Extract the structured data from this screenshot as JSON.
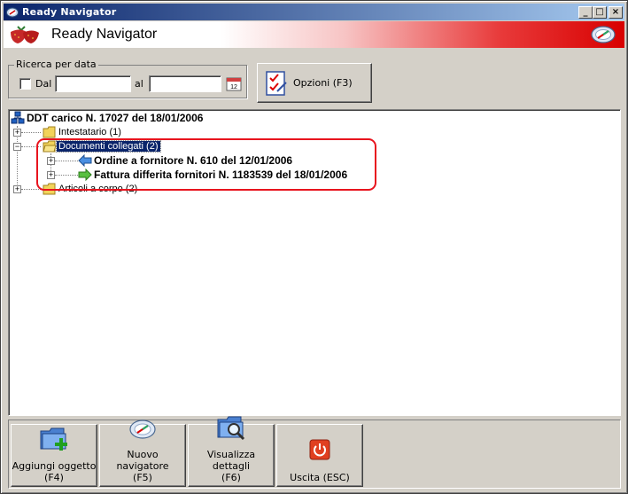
{
  "window": {
    "title": "Ready Navigator",
    "controls": {
      "minimize": "_",
      "maximize": "□",
      "close": "×"
    }
  },
  "banner": {
    "title": "Ready Navigator"
  },
  "search": {
    "group_label": "Ricerca per data",
    "from_label": "Dal",
    "from_value": "",
    "to_label": "al",
    "to_value": "",
    "from_checked": false
  },
  "options_button": {
    "label": "Opzioni (F3)"
  },
  "tree": {
    "root": "DDT carico N. 17027 del 18/01/2006",
    "items": [
      {
        "label": "Intestatario (1)"
      },
      {
        "label": "Documenti collegati (2)",
        "children": [
          {
            "label": "Ordine a fornitore N. 610 del 12/01/2006"
          },
          {
            "label": "Fattura differita fornitori N. 1183539 del 18/01/2006"
          }
        ]
      },
      {
        "label": "Articoli a corpo (2)"
      }
    ]
  },
  "bottom_buttons": {
    "add": {
      "line1": "Aggiungi oggetto",
      "line2": "(F4)"
    },
    "new_nav": {
      "line1": "Nuovo navigatore",
      "line2": "(F5)"
    },
    "details": {
      "line1": "Visualizza dettagli",
      "line2": "(F6)"
    },
    "exit": {
      "line1": "Uscita (ESC)"
    }
  },
  "colors": {
    "titlebar_start": "#0a246a",
    "titlebar_end": "#a6caf0",
    "highlight": "#e8141e",
    "selection": "#0a246a"
  }
}
